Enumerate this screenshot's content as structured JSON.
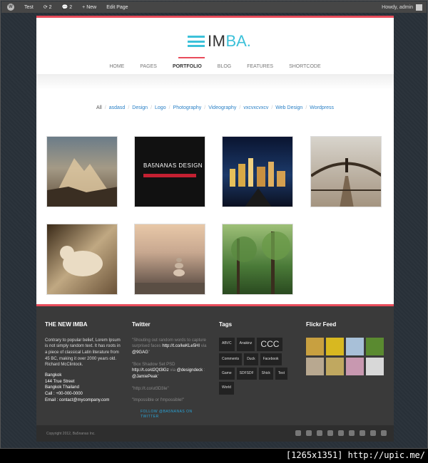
{
  "admin_bar": {
    "items": [
      "Test",
      "2",
      "2",
      "New",
      "Edit Page"
    ],
    "greeting": "Howdy, admin"
  },
  "logo": {
    "part1": "IM",
    "part2": "BA."
  },
  "nav": [
    "HOME",
    "PAGES",
    "PORTFOLIO",
    "BLOG",
    "FEATURES",
    "SHORTCODE"
  ],
  "nav_active": "PORTFOLIO",
  "filters": [
    "All",
    "asdasd",
    "Design",
    "Logo",
    "Photography",
    "Videography",
    "vxcvxcvxcv",
    "Web Design",
    "Wordpress"
  ],
  "portfolio": [
    {
      "name": "mountain"
    },
    {
      "name": "ba5nanas-design",
      "title": "BA5NANAS DESIGN"
    },
    {
      "name": "city-night"
    },
    {
      "name": "bridge"
    },
    {
      "name": "sepia-animal"
    },
    {
      "name": "stones-beach"
    },
    {
      "name": "forest"
    }
  ],
  "footer": {
    "about": {
      "title": "THE NEW IMBA",
      "text": "Contrary to popular belief, Lorem Ipsum is not simply random text. It has roots in a piece of classical Latin literature from 45 BC, making it over 2000 years old. Richard McClintock.",
      "addr1": "Bangkok",
      "addr2": "144 True Street",
      "addr3": "Bangkok Thailand",
      "call": "Call : +00-000-0000",
      "email": "Email : contact@mycompany.com"
    },
    "twitter": {
      "title": "Twitter",
      "t1a": "\"Shouting out random words to capture surprised faces ",
      "t1b": "http://t.co/keKLe5HI",
      "t1c": " via ",
      "t1d": "@9GAG",
      "t1e": "\"",
      "t2a": "\"Box Shadow Set PSD ",
      "t2b": "http://t.co/d2Qt3lGz",
      "t2c": " via ",
      "t2d": "@designdeck",
      "t2e": " : ",
      "t2f": "@JamiePeak",
      "t2g": "\"",
      "t3": "\"http://t.co/ut3D3Ie\"",
      "t4": "\"Impossible or I'mpossible!\"",
      "follow": "FOLLOW @BA5NANAS ON TWITTER"
    },
    "tags": {
      "title": "Tags",
      "items": [
        "ABVC",
        "Anakinz",
        "CCC",
        "Comments",
        "Duck",
        "Facebook",
        "Game",
        "SDFSDF",
        "Shick",
        "Test",
        "World"
      ]
    },
    "flickr": {
      "title": "Flickr Feed"
    }
  },
  "copyright": "Copyright 2012, Ba5nanas Inc.",
  "caption": "[1265x1351] http://upic.me/"
}
